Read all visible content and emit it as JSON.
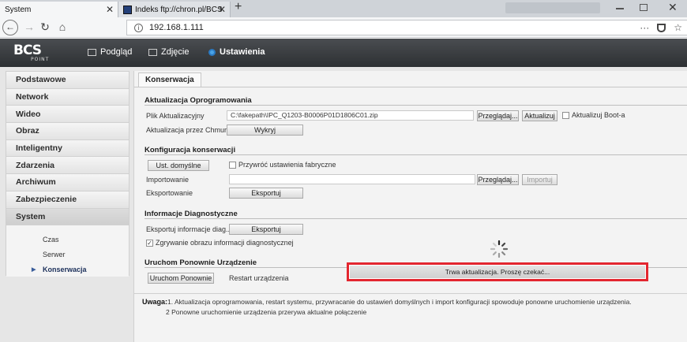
{
  "browser": {
    "tabs": [
      {
        "label": "System"
      },
      {
        "label": "Indeks ftp://chron.pl/BCS/FIRM"
      }
    ],
    "url": "192.168.1.111"
  },
  "app": {
    "logo": "BCS",
    "logo_sub": "POINT",
    "nav": [
      {
        "label": "Podgląd"
      },
      {
        "label": "Zdjęcie"
      },
      {
        "label": "Ustawienia"
      }
    ]
  },
  "sidebar": {
    "items": [
      {
        "label": "Podstawowe"
      },
      {
        "label": "Network"
      },
      {
        "label": "Wideo"
      },
      {
        "label": "Obraz"
      },
      {
        "label": "Inteligentny"
      },
      {
        "label": "Zdarzenia"
      },
      {
        "label": "Archiwum"
      },
      {
        "label": "Zabezpieczenie"
      },
      {
        "label": "System"
      }
    ],
    "subitems": [
      {
        "label": "Czas"
      },
      {
        "label": "Serwer"
      },
      {
        "label": "Konserwacja"
      }
    ]
  },
  "content": {
    "tab": "Konserwacja",
    "firmware": {
      "title": "Aktualizacja Oprogramowania",
      "file_label": "Plik Aktualizacyjny",
      "file_value": "C:\\fakepath\\IPC_Q1203-B0006P01D1806C01.zip",
      "browse": "Przeglądaj...",
      "update": "Aktualizuj",
      "boot_label": "Aktualizuj Boot-a",
      "cloud_label": "Aktualizacja przez Chmure",
      "cloud_btn": "Wykryj"
    },
    "maint": {
      "title": "Konfiguracja konserwacji",
      "defaults_btn": "Ust. domyślne",
      "factory_label": "Przywróć ustawienia fabryczne",
      "import_label": "Importowanie",
      "import_browse": "Przeglądaj...",
      "import_btn": "Importuj",
      "export_label": "Eksportowanie",
      "export_btn": "Eksportuj"
    },
    "diag": {
      "title": "Informacje Diagnostyczne",
      "export_label": "Eksportuj informacje diag...",
      "export_btn": "Eksportuj",
      "capture_label": "Zgrywanie obrazu informacji diagnostycznej"
    },
    "reboot": {
      "title": "Uruchom Ponownie Urządzenie",
      "btn": "Uruchom Ponownie",
      "label": "Restart urządzenia"
    },
    "progress_text": "Trwa aktualizacja. Proszę czekać...",
    "note_title": "Uwaga:",
    "note_1": "1. Aktualizacja oprogramowania, restart systemu, przywracanie do ustawień domyślnych i import konfiguracji spowoduje ponowne uruchomienie urządzenia.",
    "note_2": "2 Ponowne uruchomienie urządzenia przerywa aktualne połączenie"
  }
}
